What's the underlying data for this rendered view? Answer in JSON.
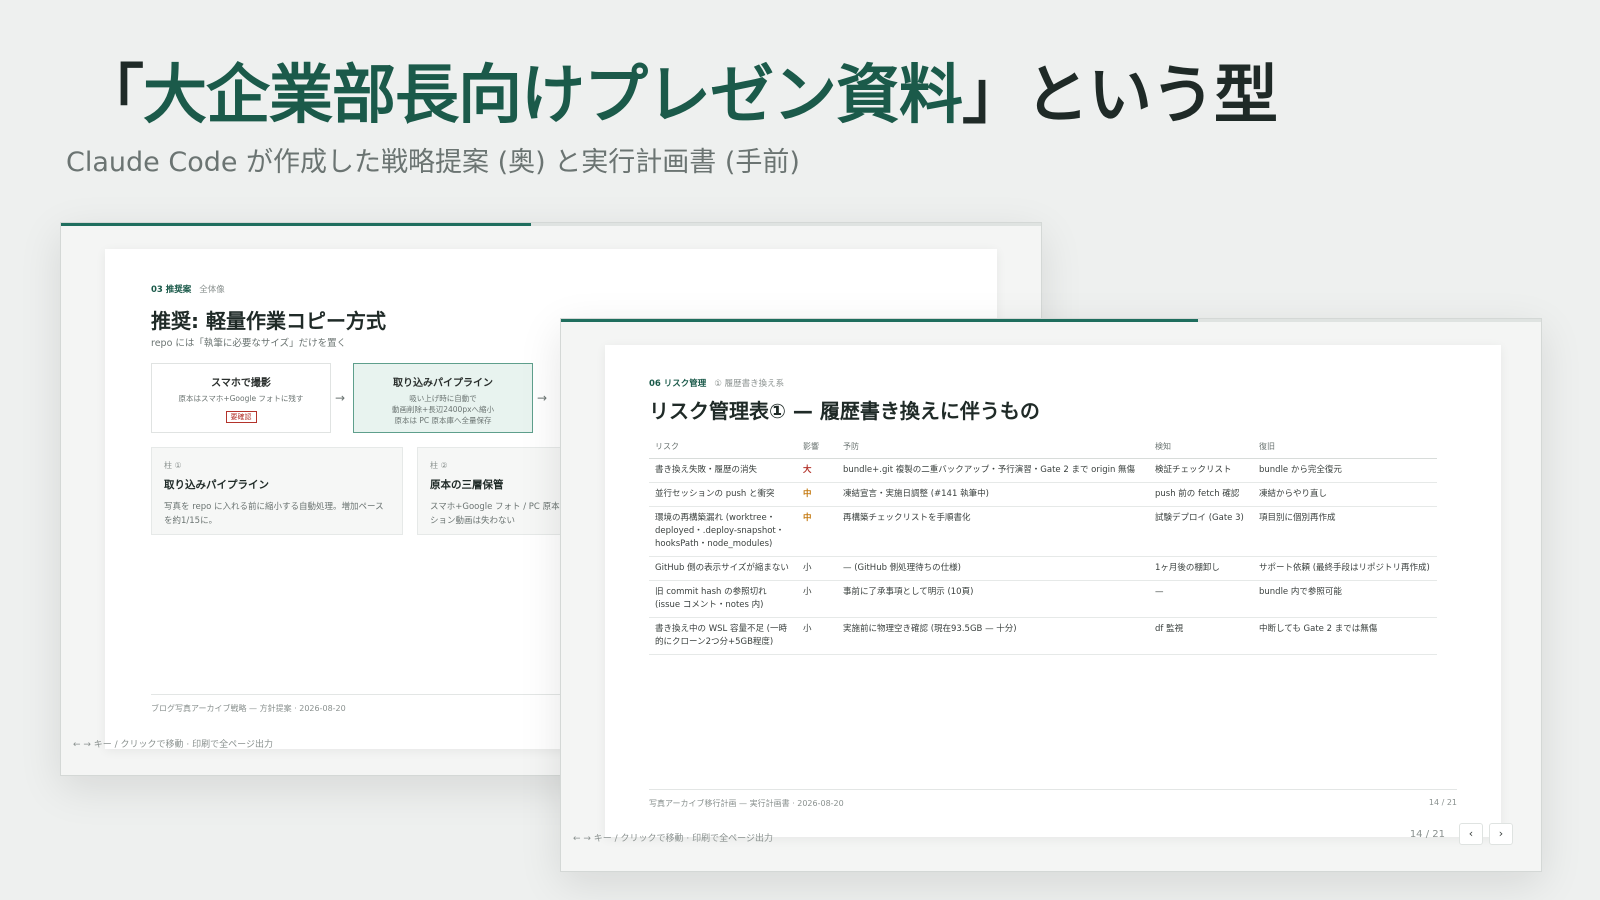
{
  "headline": {
    "open_bracket": "「",
    "accent": "大企業部長向けプレゼン資料",
    "rest": "」という型"
  },
  "subtitle": "Claude Code が作成した戦略提案 (奥) と実行計画書 (手前)",
  "back_window": {
    "progress": 0.48,
    "kicker_num": "03 推奨案",
    "kicker_label": "全体像",
    "title": "推奨: 軽量作業コピー方式",
    "subtitle": "repo には「執筆に必要なサイズ」だけを置く",
    "steps": [
      {
        "title": "スマホで撮影",
        "desc1": "原本はスマホ+Google フォトに残す",
        "tag": "要確認"
      },
      {
        "title": "取り込みパイプライン",
        "desc1": "吸い上げ時に自動で",
        "desc2": "動画削除+長辺2400pxへ縮小",
        "desc3": "原本は PC 原本庫へ全量保存"
      }
    ],
    "arrow": "→",
    "pillars": [
      {
        "label": "柱 ①",
        "title": "取り込みパイプライン",
        "desc": "写真を repo に入れる前に縮小する自動処理。増加ペースを約1/15に。"
      },
      {
        "label": "柱 ②",
        "title": "原本の三層保管",
        "desc": "スマホ+Google フォト / PC 原本庫 / 外付け。原寸・モーション動画は失わない"
      }
    ],
    "footer": "ブログ写真アーカイブ戦略 — 方針提案 · 2026-08-20",
    "nav_hint": "← → キー / クリックで移動 · 印刷で全ページ出力"
  },
  "front_window": {
    "progress": 0.65,
    "kicker_num": "06 リスク管理",
    "kicker_label": "① 履歴書き換え系",
    "title": "リスク管理表① — 履歴書き換えに伴うもの",
    "columns": [
      "リスク",
      "影響",
      "予防",
      "検知",
      "復旧"
    ],
    "rows": [
      {
        "risk": "書き換え失敗・履歴の消失",
        "impact": "大",
        "level": "big",
        "prevent": "bundle+.git 複製の二重バックアップ・予行演習・Gate 2 まで origin 無傷",
        "detect": "検証チェックリスト",
        "recover": "bundle から完全復元"
      },
      {
        "risk": "並行セッションの push と衝突",
        "impact": "中",
        "level": "mid",
        "prevent": "凍結宣言・実施日調整 (#141 執筆中)",
        "detect": "push 前の fetch 確認",
        "recover": "凍結からやり直し"
      },
      {
        "risk": "環境の再構築漏れ (worktree・deployed・.deploy-snapshot・hooksPath・node_modules)",
        "impact": "中",
        "level": "mid",
        "prevent": "再構築チェックリストを手順書化",
        "detect": "試験デプロイ (Gate 3)",
        "recover": "項目別に個別再作成"
      },
      {
        "risk": "GitHub 側の表示サイズが縮まない",
        "impact": "小",
        "level": "small",
        "prevent": "— (GitHub 側処理待ちの仕様)",
        "detect": "1ヶ月後の棚卸し",
        "recover": "サポート依頼 (最終手段はリポジトリ再作成)"
      },
      {
        "risk": "旧 commit hash の参照切れ (issue コメント・notes 内)",
        "impact": "小",
        "level": "small",
        "prevent": "事前に了承事項として明示 (10頁)",
        "detect": "—",
        "recover": "bundle 内で参照可能"
      },
      {
        "risk": "書き換え中の WSL 容量不足 (一時的にクローン2つ分+5GB程度)",
        "impact": "小",
        "level": "small",
        "prevent": "実施前に物理空き確認 (現在93.5GB — 十分)",
        "detect": "df 監視",
        "recover": "中断しても Gate 2 までは無傷"
      }
    ],
    "footer": "写真アーカイブ移行計画 — 実行計画書 · 2026-08-20",
    "page_no": "14 / 21",
    "pager_count": "14 / 21",
    "prev_label": "‹",
    "next_label": "›",
    "nav_hint": "← → キー / クリックで移動 · 印刷で全ページ出力"
  }
}
